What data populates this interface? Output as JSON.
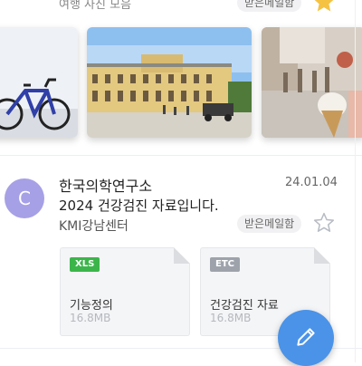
{
  "previous_mail": {
    "description": "여행 사진 모음",
    "badge": "받은메일함",
    "star_icon": "star-filled-icon",
    "star_color": "#f5c242"
  },
  "gallery": {
    "photos": [
      {
        "name": "bicycle-photo"
      },
      {
        "name": "palace-photo"
      },
      {
        "name": "ice-cream-street-photo"
      }
    ]
  },
  "mail": {
    "avatar_letter": "C",
    "avatar_color": "#a6a0e6",
    "sender": "한국의학연구소",
    "date": "24.01.04",
    "subject": "2024 건강검진 자료입니다.",
    "from_label": "KMI강남센터",
    "badge": "받은메일함",
    "star_icon": "star-outline-icon",
    "attachments": [
      {
        "ext": "XLS",
        "ext_color": "#3bb54a",
        "name": "기능정의",
        "size": "16.8MB"
      },
      {
        "ext": "ETC",
        "ext_color": "#9ea3ab",
        "name": "건강검진 자료",
        "size": "16.8MB"
      }
    ]
  },
  "fab": {
    "icon": "pencil-icon",
    "color": "#4a93e8"
  }
}
